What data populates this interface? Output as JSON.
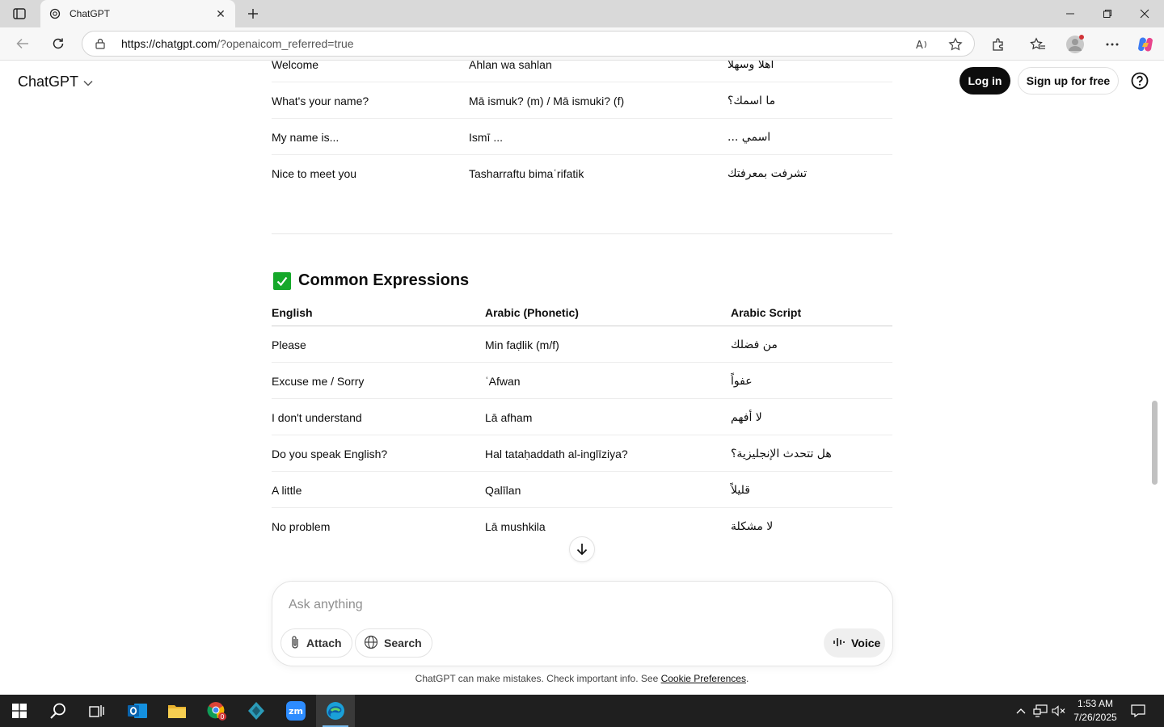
{
  "browser": {
    "tab_title": "ChatGPT",
    "url_host": "https://chatgpt.com",
    "url_rest": "/?openaicom_referred=true",
    "accent": "#0078d4"
  },
  "header": {
    "brand": "ChatGPT",
    "login_label": "Log in",
    "signup_label": "Sign up for free"
  },
  "table1": {
    "rows": [
      {
        "english": "Welcome",
        "phonetic": "Ahlan wa sahlan",
        "script": "اهلا وسهلا"
      },
      {
        "english": "What's your name?",
        "phonetic": "Mā ismuk? (m) / Mā ismuki? (f)",
        "script": "ما اسمك؟"
      },
      {
        "english": "My name is...",
        "phonetic": "Ismī ...",
        "script": "اسمي ..."
      },
      {
        "english": "Nice to meet you",
        "phonetic": "Tasharraftu bimaʿrifatik",
        "script": "تشرفت بمعرفتك"
      }
    ]
  },
  "section2": {
    "emoji": "✔",
    "title": "Common Expressions",
    "headers": {
      "english": "English",
      "phonetic": "Arabic (Phonetic)",
      "script": "Arabic Script"
    },
    "rows": [
      {
        "english": "Please",
        "phonetic": "Min faḍlik (m/f)",
        "script": "من فضلك"
      },
      {
        "english": "Excuse me / Sorry",
        "phonetic": "ʿAfwan",
        "script": "عفواً"
      },
      {
        "english": "I don't understand",
        "phonetic": "Lā afham",
        "script": "لا أفهم"
      },
      {
        "english": "Do you speak English?",
        "phonetic": "Hal tataḥaddath al-inglīziya?",
        "script": "هل تتحدث الإنجليزية؟"
      },
      {
        "english": "A little",
        "phonetic": "Qalīlan",
        "script": "قليلاً"
      },
      {
        "english": "No problem",
        "phonetic": "Lā mushkila",
        "script": "لا مشكلة"
      }
    ]
  },
  "composer": {
    "placeholder": "Ask anything",
    "attach_label": "Attach",
    "search_label": "Search",
    "voice_label": "Voice"
  },
  "footer": {
    "disclaimer": "ChatGPT can make mistakes. Check important info. See ",
    "link": "Cookie Preferences",
    "end": "."
  },
  "taskbar": {
    "time": "1:53 AM",
    "date": "7/26/2025",
    "chrome_badge": "0"
  }
}
